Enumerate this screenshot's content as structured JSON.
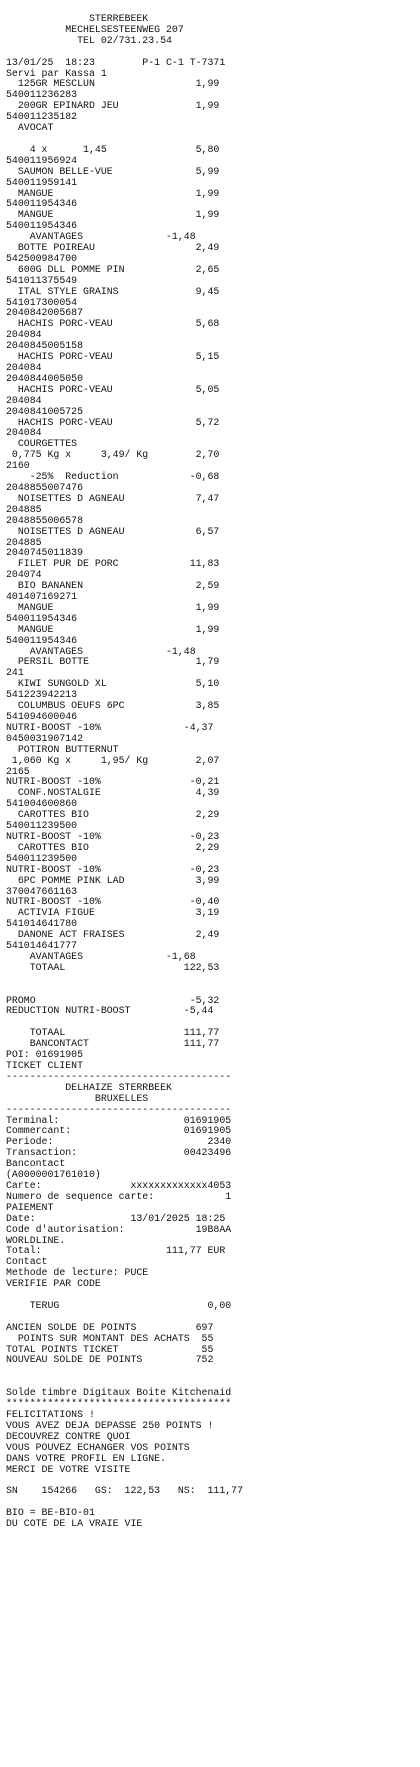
{
  "receipt": {
    "lines": [
      "              STERREBEEK",
      "          MECHELSESTEENWEG 207",
      "            TEL 02/731.23.54",
      "",
      "13/01/25  18:23        P-1 C-1 T-7371",
      "Servi par Kassa 1",
      "  125GR MESCLUN                 1,99",
      "540011236283",
      "  200GR EPINARD JEU             1,99",
      "540011235182",
      "  AVOCAT",
      "",
      "    4 x      1,45               5,80",
      "540011956924",
      "  SAUMON BELLE-VUE              5,99",
      "540011959141",
      "  MANGUE                        1,99",
      "540011954346",
      "  MANGUE                        1,99",
      "540011954346",
      "    AVANTAGES              -1,48",
      "  BOTTE POIREAU                 2,49",
      "542500984700",
      "  600G DLL POMME PIN            2,65",
      "541011375549",
      "  ITAL STYLE GRAINS             9,45",
      "541017300054",
      "2040842005687",
      "  HACHIS PORC-VEAU              5,68",
      "204084",
      "2040845005158",
      "  HACHIS PORC-VEAU              5,15",
      "204084",
      "2040844005050",
      "  HACHIS PORC-VEAU              5,05",
      "204084",
      "2040841005725",
      "  HACHIS PORC-VEAU              5,72",
      "204084",
      "  COURGETTES",
      " 0,775 Kg x     3,49/ Kg        2,70",
      "2160",
      "    -25%  Reduction            -0,68",
      "2048855007476",
      "  NOISETTES D AGNEAU            7,47",
      "204885",
      "2048855006578",
      "  NOISETTES D AGNEAU            6,57",
      "204885",
      "2040745011839",
      "  FILET PUR DE PORC            11,83",
      "204074",
      "  BIO BANANEN                   2,59",
      "401407169271",
      "  MANGUE                        1,99",
      "540011954346",
      "  MANGUE                        1,99",
      "540011954346",
      "    AVANTAGES              -1,48",
      "  PERSIL BOTTE                  1,79",
      "241",
      "  KIWI SUNGOLD XL               5,10",
      "541223942213",
      "  COLUMBUS OEUFS 6PC            3,85",
      "541094600046",
      "NUTRI-BOOST -10%              -4,37",
      "0450031907142",
      "  POTIRON BUTTERNUT",
      " 1,060 Kg x     1,95/ Kg        2,07",
      "2165",
      "NUTRI-BOOST -10%               -0,21",
      "  CONF.NOSTALGIE                4,39",
      "541004600860",
      "  CAROTTES BIO                  2,29",
      "540011239500",
      "NUTRI-BOOST -10%               -0,23",
      "  CAROTTES BIO                  2,29",
      "540011239500",
      "NUTRI-BOOST -10%               -0,23",
      "  6PC POMME PINK LAD            3,99",
      "370047661163",
      "NUTRI-BOOST -10%               -0,40",
      "  ACTIVIA FIGUE                 3,19",
      "541014641780",
      "  DANONE ACT FRAISES            2,49",
      "541014641777",
      "    AVANTAGES              -1,68",
      "    TOTAAL                    122,53",
      "",
      "",
      "PROMO                          -5,32",
      "REDUCTION NUTRI-BOOST         -5,44",
      "",
      "    TOTAAL                    111,77",
      "    BANCONTACT                111,77",
      "POI: 01691905",
      "TICKET CLIENT",
      "--------------------------------------",
      "          DELHAIZE STERRBEEK",
      "               BRUXELLES",
      "--------------------------------------",
      "Terminal:                     01691905",
      "Commercant:                   01691905",
      "Periode:                          2340",
      "Transaction:                  00423496",
      "Bancontact",
      "(A0000001761010)",
      "Carte:               xxxxxxxxxxxxx4053",
      "Numero de sequence carte:            1",
      "PAIEMENT",
      "Date:                13/01/2025 18:25",
      "Code d'autorisation:            19B8AA",
      "WORLDLINE.",
      "Total:                     111,77 EUR",
      "Contact",
      "Methode de lecture: PUCE",
      "VERIFIE PAR CODE",
      "",
      "    TERUG                         0,00",
      "",
      "ANCIEN SOLDE DE POINTS          697",
      "  POINTS SUR MONTANT DES ACHATS  55",
      "TOTAL POINTS TICKET              55",
      "NOUVEAU SOLDE DE POINTS         752",
      "",
      "",
      "Solde timbre Digitaux Boite Kitchenaid",
      "**************************************",
      "FELICITATIONS !",
      "VOUS AVEZ DEJA DEPASSE 250 POINTS !",
      "DECOUVREZ CONTRE QUOI",
      "VOUS POUVEZ ECHANGER VOS POINTS",
      "DANS VOTRE PROFIL EN LIGNE.",
      "MERCI DE VOTRE VISITE",
      "",
      "SN    154266   GS:  122,53   NS:  111,77",
      "",
      "BIO = BE-BIO-01",
      "DU COTE DE LA VRAIE VIE"
    ]
  }
}
